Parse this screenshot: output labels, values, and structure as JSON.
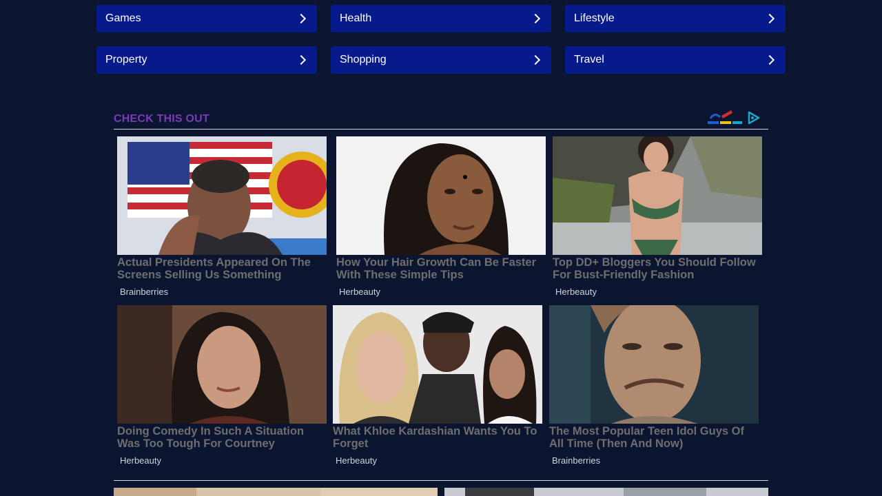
{
  "categories": [
    {
      "label": "Games"
    },
    {
      "label": "Health"
    },
    {
      "label": "Lifestyle"
    },
    {
      "label": "Property"
    },
    {
      "label": "Shopping"
    },
    {
      "label": "Travel"
    }
  ],
  "section": {
    "title": "CHECK THIS OUT"
  },
  "cards": [
    {
      "title": "Actual Presidents Appeared On The Screens Selling Us Something",
      "source": "Brainberries"
    },
    {
      "title": "How Your Hair Growth Can Be Faster With These Simple Tips",
      "source": "Herbeauty"
    },
    {
      "title": "Top DD+ Bloggers You Should Follow For Bust-Friendly Fashion",
      "source": "Herbeauty"
    },
    {
      "title": "Doing Comedy In Such A Situation Was Too Tough For Courtney",
      "source": "Herbeauty"
    },
    {
      "title": "What Khloe Kardashian Wants You To Forget",
      "source": "Herbeauty"
    },
    {
      "title": "The Most Popular Teen Idol Guys Of All Time (Then And Now)",
      "source": "Brainberries"
    }
  ],
  "colors": {
    "background": "#0b1530",
    "category_button": "#061a8c",
    "section_title": "#7a3bb8",
    "card_title": "#6e6e6e"
  }
}
